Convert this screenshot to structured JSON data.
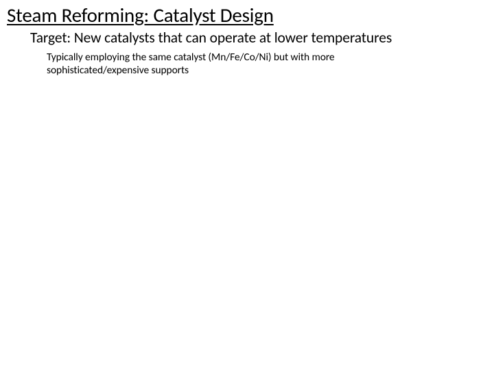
{
  "slide": {
    "title": "Steam Reforming: Catalyst Design",
    "subtitle": "Target: New catalysts that can operate at lower temperatures",
    "body": "Typically employing the same catalyst (Mn/Fe/Co/Ni) but with more sophisticated/expensive supports"
  }
}
